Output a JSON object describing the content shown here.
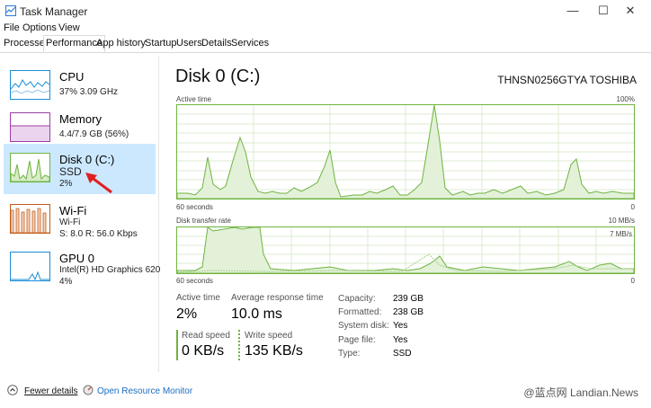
{
  "window": {
    "title": "Task Manager"
  },
  "menu": [
    "File",
    "Options",
    "View"
  ],
  "tabs": [
    "Processes",
    "Performance",
    "App history",
    "Startup",
    "Users",
    "Details",
    "Services"
  ],
  "sidebar": [
    {
      "name": "CPU",
      "sub1": "37%  3.09 GHz"
    },
    {
      "name": "Memory",
      "sub1": "4.4/7.9 GB (56%)"
    },
    {
      "name": "Disk 0 (C:)",
      "sub1": "SSD",
      "sub2": "2%"
    },
    {
      "name": "Wi-Fi",
      "sub1": "Wi-Fi",
      "sub2": "S: 8.0  R: 56.0 Kbps"
    },
    {
      "name": "GPU 0",
      "sub1": "Intel(R) HD Graphics 620",
      "sub2": "4%"
    }
  ],
  "main": {
    "title": "Disk 0 (C:)",
    "model": "THNSN0256GTYA TOSHIBA",
    "graph1": {
      "label": "Active time",
      "max": "100%",
      "time": "60 seconds",
      "min": "0"
    },
    "graph2": {
      "label": "Disk transfer rate",
      "max": "10 MB/s",
      "inner": "7 MB/s",
      "time": "60 seconds",
      "min": "0"
    }
  },
  "stats": {
    "active_time_label": "Active time",
    "active_time": "2%",
    "avg_response_label": "Average response time",
    "avg_response": "10.0 ms",
    "read_label": "Read speed",
    "read": "0 KB/s",
    "write_label": "Write speed",
    "write": "135 KB/s"
  },
  "props": [
    {
      "k": "Capacity:",
      "v": "239 GB"
    },
    {
      "k": "Formatted:",
      "v": "238 GB"
    },
    {
      "k": "System disk:",
      "v": "Yes"
    },
    {
      "k": "Page file:",
      "v": "Yes"
    },
    {
      "k": "Type:",
      "v": "SSD"
    }
  ],
  "footer": {
    "fewer": "Fewer details",
    "monitor": "Open Resource Monitor",
    "watermark": "@蓝点网 Landian.News"
  },
  "colors": {
    "disk": "#6fb43f",
    "cpu": "#1a8dd8",
    "memory": "#9c3fa6",
    "wifi": "#c45b17",
    "selection": "#cce8ff"
  }
}
